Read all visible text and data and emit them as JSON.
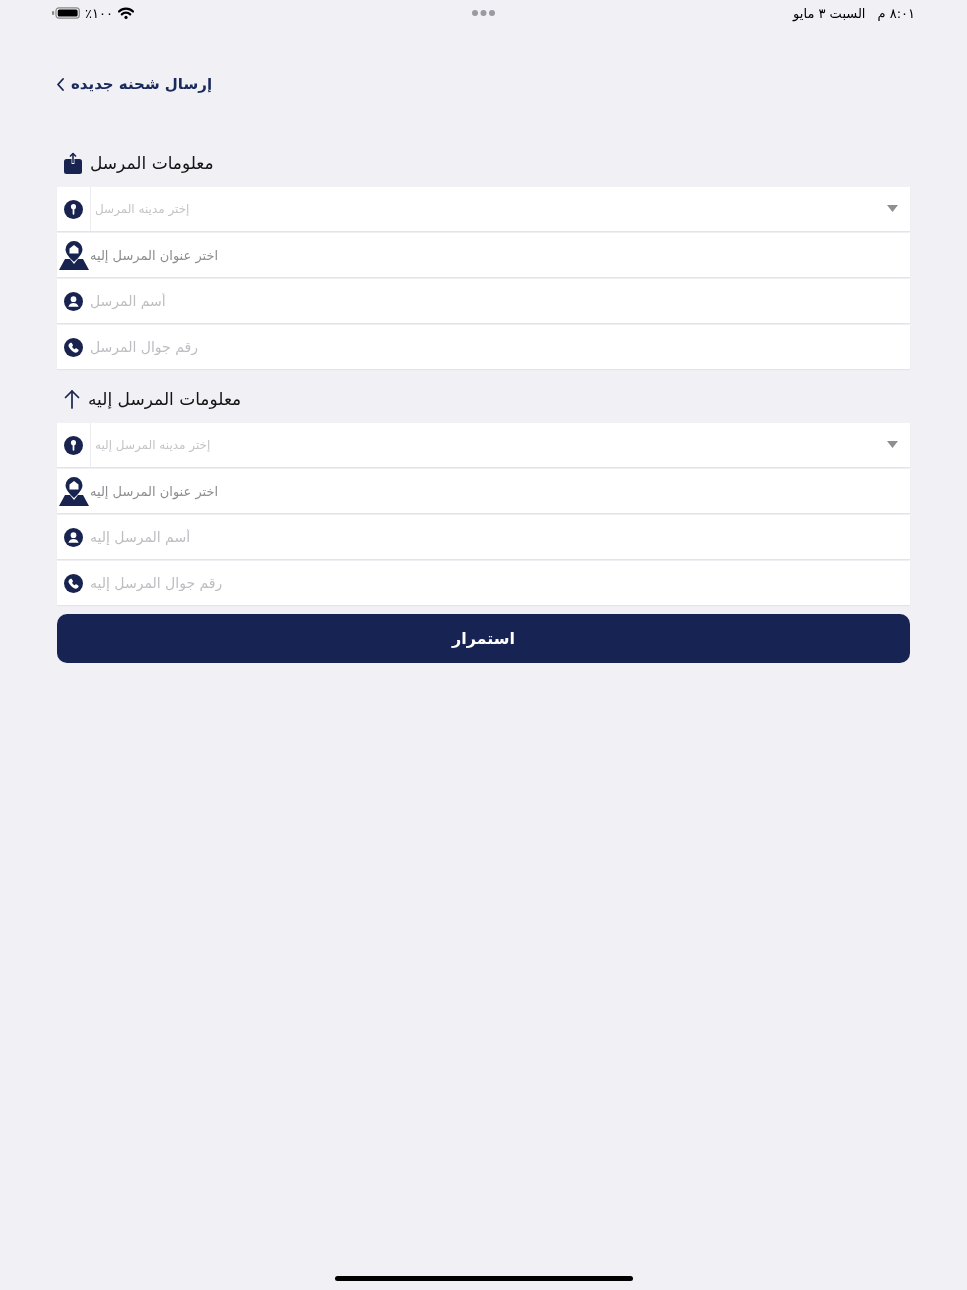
{
  "status_bar": {
    "battery": "١٠٠٪",
    "time": "٨:٠١ م",
    "date": "السبت ٣ مايو"
  },
  "nav": {
    "title": "إرسال شحنه جديده"
  },
  "sections": [
    {
      "kind": "sender",
      "title": "معلومات المرسل",
      "fields": [
        {
          "kind": "city",
          "placeholder": "إختر مدينه المرسل"
        },
        {
          "kind": "address",
          "label": "اختر عنوان المرسل إليه"
        },
        {
          "kind": "name",
          "placeholder": "أسم المرسل"
        },
        {
          "kind": "phone",
          "placeholder": "رقم جوال المرسل"
        }
      ]
    },
    {
      "kind": "receiver",
      "title": "معلومات المرسل إليه",
      "fields": [
        {
          "kind": "city",
          "placeholder": "إختر مدينه المرسل إليه"
        },
        {
          "kind": "address",
          "label": "اختر عنوان المرسل إليه"
        },
        {
          "kind": "name",
          "placeholder": "أسم المرسل إليه"
        },
        {
          "kind": "phone",
          "placeholder": "رقم جوال المرسل إليه"
        }
      ]
    }
  ],
  "continue_button": {
    "label": "استمرار"
  }
}
